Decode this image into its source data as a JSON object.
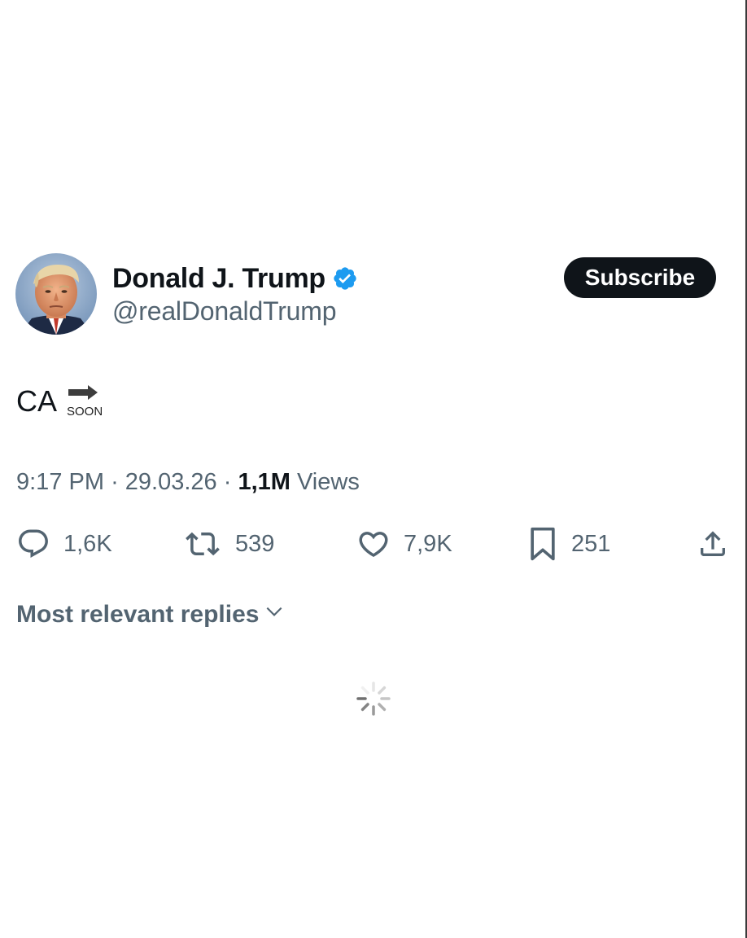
{
  "author": {
    "display_name": "Donald J. Trump",
    "handle": "@realDonaldTrump",
    "verified": true,
    "verified_color": "#1d9bf0"
  },
  "header": {
    "subscribe_label": "Subscribe"
  },
  "tweet": {
    "text": "CA",
    "emoji_label": "SOON",
    "emoji_icon": "soon-arrow-icon"
  },
  "meta": {
    "time": "9:17 PM",
    "separator": "·",
    "date": "29.03.26",
    "views_count": "1,1M",
    "views_label": "Views"
  },
  "actions": {
    "replies": "1,6K",
    "reposts": "539",
    "likes": "7,9K",
    "bookmarks": "251"
  },
  "replies": {
    "sort_label": "Most relevant replies"
  },
  "colors": {
    "text_primary": "#0f1419",
    "text_secondary": "#536471",
    "button_bg": "#0f1419"
  }
}
